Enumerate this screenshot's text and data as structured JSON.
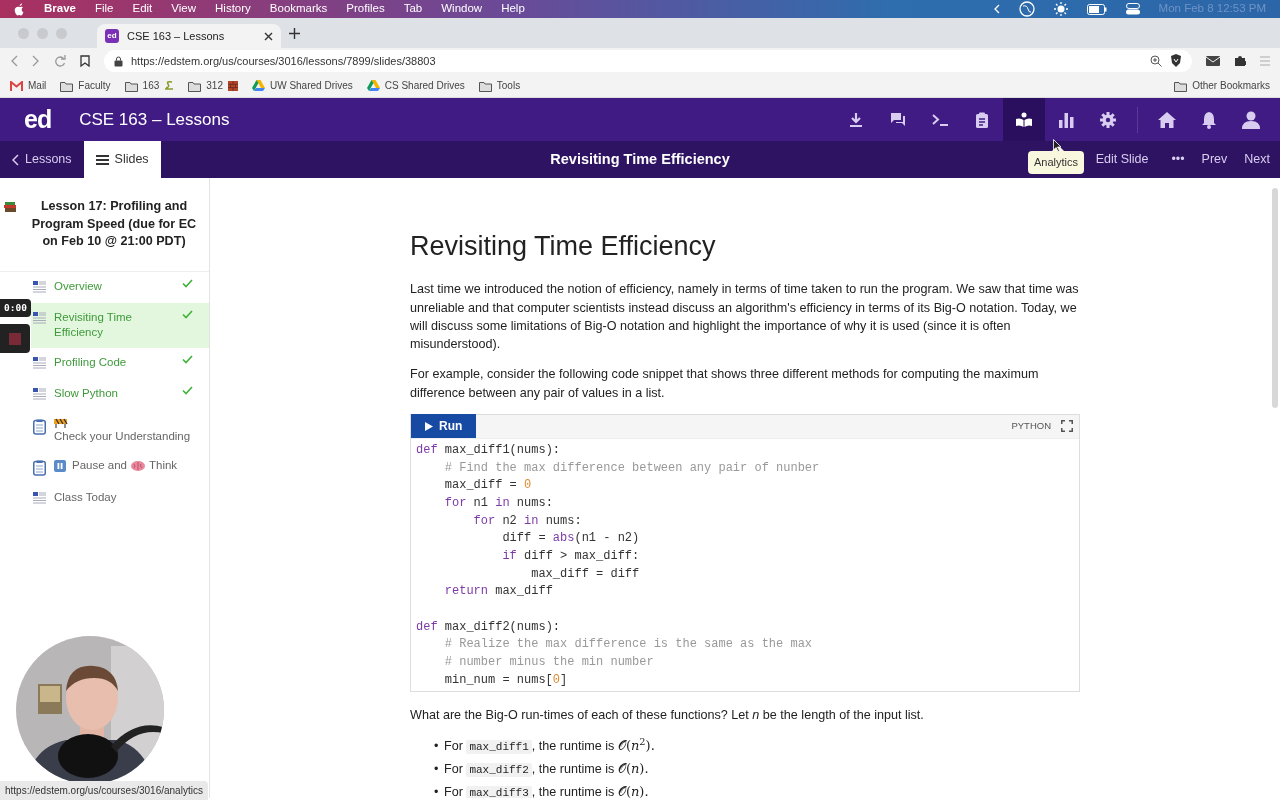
{
  "menu_bar": {
    "app": "Brave",
    "items": [
      "File",
      "Edit",
      "View",
      "History",
      "Bookmarks",
      "Profiles",
      "Tab",
      "Window",
      "Help"
    ],
    "clock": "Mon Feb 8  12:53 PM"
  },
  "browser": {
    "tab": {
      "favicon": "ed",
      "title": "CSE 163 – Lessons"
    },
    "url": "https://edstem.org/us/courses/3016/lessons/7899/slides/38803",
    "bookmarks": [
      {
        "kind": "mail",
        "label": "Mail"
      },
      {
        "kind": "folder",
        "label": "Faculty"
      },
      {
        "kind": "folder-snake",
        "label": "163"
      },
      {
        "kind": "folder-brick",
        "label": "312"
      },
      {
        "kind": "drive",
        "label": "UW Shared Drives"
      },
      {
        "kind": "drive",
        "label": "CS Shared Drives"
      },
      {
        "kind": "folder",
        "label": "Tools"
      }
    ],
    "other_bookmarks": "Other Bookmarks"
  },
  "app": {
    "logo": "ed",
    "title": "CSE 163 – Lessons",
    "toolbar": [
      {
        "kind": "download",
        "selected": false
      },
      {
        "kind": "chat",
        "selected": false
      },
      {
        "kind": "terminal",
        "selected": false
      },
      {
        "kind": "clipboard",
        "selected": false
      },
      {
        "kind": "lesson",
        "selected": true
      },
      {
        "kind": "analytics",
        "selected": false
      },
      {
        "kind": "settings",
        "selected": false
      },
      {
        "kind": "home",
        "selected": false
      },
      {
        "kind": "bell",
        "selected": false
      },
      {
        "kind": "user",
        "selected": false
      }
    ],
    "tabs": [
      {
        "kind": "back",
        "label": "Lessons",
        "selected": false
      },
      {
        "kind": "list",
        "label": "Slides",
        "selected": true
      }
    ],
    "slide_title": "Revisiting Time Efficiency",
    "actions": [
      "Edit Slide",
      "•••",
      "Prev",
      "Next"
    ],
    "tooltip": "Analytics"
  },
  "sidebar": {
    "lesson_title": "Lesson 17: Profiling and Program Speed (due for EC on Feb 10 @ 21:00 PDT)",
    "items": [
      {
        "kind": "document",
        "parts": [
          {
            "kind": "text",
            "text": "Overview"
          }
        ],
        "completed": true,
        "selected": false
      },
      {
        "kind": "document",
        "parts": [
          {
            "kind": "text",
            "text": "Revisiting Time Efficiency"
          }
        ],
        "completed": true,
        "selected": true
      },
      {
        "kind": "document",
        "parts": [
          {
            "kind": "text",
            "text": "Profiling Code"
          }
        ],
        "completed": true,
        "selected": false
      },
      {
        "kind": "document",
        "parts": [
          {
            "kind": "text",
            "text": "Slow Python"
          }
        ],
        "completed": true,
        "selected": false
      },
      {
        "kind": "quiz",
        "parts": [
          {
            "kind": "emoji-barrier"
          },
          {
            "kind": "text",
            "text": "Check your Understanding"
          }
        ],
        "completed": false,
        "selected": false
      },
      {
        "kind": "quiz",
        "parts": [
          {
            "kind": "emoji-pause"
          },
          {
            "kind": "text",
            "text": "Pause and"
          },
          {
            "kind": "emoji-brain"
          },
          {
            "kind": "text",
            "text": "Think"
          }
        ],
        "completed": false,
        "selected": false
      },
      {
        "kind": "document",
        "parts": [
          {
            "kind": "text",
            "text": "Class Today"
          }
        ],
        "completed": false,
        "selected": false
      }
    ]
  },
  "recorder": {
    "timer": "0:00"
  },
  "slide": {
    "heading": "Revisiting Time Efficiency",
    "paragraphs": [
      "Last time we introduced the notion of efficiency, namely in terms of time taken to run the program. We saw that time was unreliable and that computer scientists instead discuss an algorithm's efficiency in terms of its Big-O notation. Today, we will discuss some limitations of Big-O notation and highlight the importance of why it is used (since it is often misunderstood).",
      "For example, consider the following code snippet that shows three different methods for computing the maximum difference between any pair of values in a list."
    ],
    "code": {
      "run": "Run",
      "language": "PYTHON",
      "lines": [
        {
          "kind": "code",
          "tokens": [
            {
              "kind": "keyword",
              "text": "def"
            },
            {
              "kind": "plain",
              "text": " max_diff1(nums):"
            }
          ]
        },
        {
          "kind": "code",
          "tokens": [
            {
              "kind": "comment",
              "text": "    # Find the max difference between any pair of nunber"
            }
          ]
        },
        {
          "kind": "code",
          "tokens": [
            {
              "kind": "plain",
              "text": "    max_diff = "
            },
            {
              "kind": "number",
              "text": "0"
            }
          ]
        },
        {
          "kind": "code",
          "tokens": [
            {
              "kind": "keyword",
              "text": "    for"
            },
            {
              "kind": "plain",
              "text": " n1 "
            },
            {
              "kind": "keyword",
              "text": "in"
            },
            {
              "kind": "plain",
              "text": " nums:"
            }
          ]
        },
        {
          "kind": "code",
          "tokens": [
            {
              "kind": "keyword",
              "text": "        for"
            },
            {
              "kind": "plain",
              "text": " n2 "
            },
            {
              "kind": "keyword",
              "text": "in"
            },
            {
              "kind": "plain",
              "text": " nums:"
            }
          ]
        },
        {
          "kind": "code",
          "tokens": [
            {
              "kind": "plain",
              "text": "            diff = "
            },
            {
              "kind": "keyword",
              "text": "abs"
            },
            {
              "kind": "plain",
              "text": "(n1 - n2)"
            }
          ]
        },
        {
          "kind": "code",
          "tokens": [
            {
              "kind": "keyword",
              "text": "            if"
            },
            {
              "kind": "plain",
              "text": " diff > max_diff:"
            }
          ]
        },
        {
          "kind": "code",
          "tokens": [
            {
              "kind": "plain",
              "text": "                max_diff = diff"
            }
          ]
        },
        {
          "kind": "code",
          "tokens": [
            {
              "kind": "keyword",
              "text": "    return"
            },
            {
              "kind": "plain",
              "text": " max_diff"
            }
          ]
        },
        {
          "kind": "blank"
        },
        {
          "kind": "code",
          "tokens": [
            {
              "kind": "keyword",
              "text": "def"
            },
            {
              "kind": "plain",
              "text": " max_diff2(nums):"
            }
          ]
        },
        {
          "kind": "code",
          "tokens": [
            {
              "kind": "comment",
              "text": "    # Realize the max difference is the same as the max"
            }
          ]
        },
        {
          "kind": "code",
          "tokens": [
            {
              "kind": "comment",
              "text": "    # number minus the min number"
            }
          ]
        },
        {
          "kind": "code",
          "tokens": [
            {
              "kind": "plain",
              "text": "    min_num = nums["
            },
            {
              "kind": "number",
              "text": "0"
            },
            {
              "kind": "plain",
              "text": "]"
            }
          ]
        }
      ]
    },
    "question": "What are the Big-O run-times of each of these functions? Let *n* be the length of the input list.",
    "bullets": [
      {
        "marker": "•",
        "before": "For",
        "code": "max_diff1",
        "after": ", the runtime is",
        "math": "𝒪(*n*$^{2}$)."
      },
      {
        "marker": "•",
        "before": "For",
        "code": "max_diff2",
        "after": ", the runtime is",
        "math": "𝒪(*n*)."
      },
      {
        "marker": "•",
        "before": "For",
        "code": "max_diff3",
        "after": ", the runtime is",
        "math": "𝒪(*n*)."
      }
    ]
  },
  "status_url": "https://edstem.org/us/courses/3016/analytics"
}
